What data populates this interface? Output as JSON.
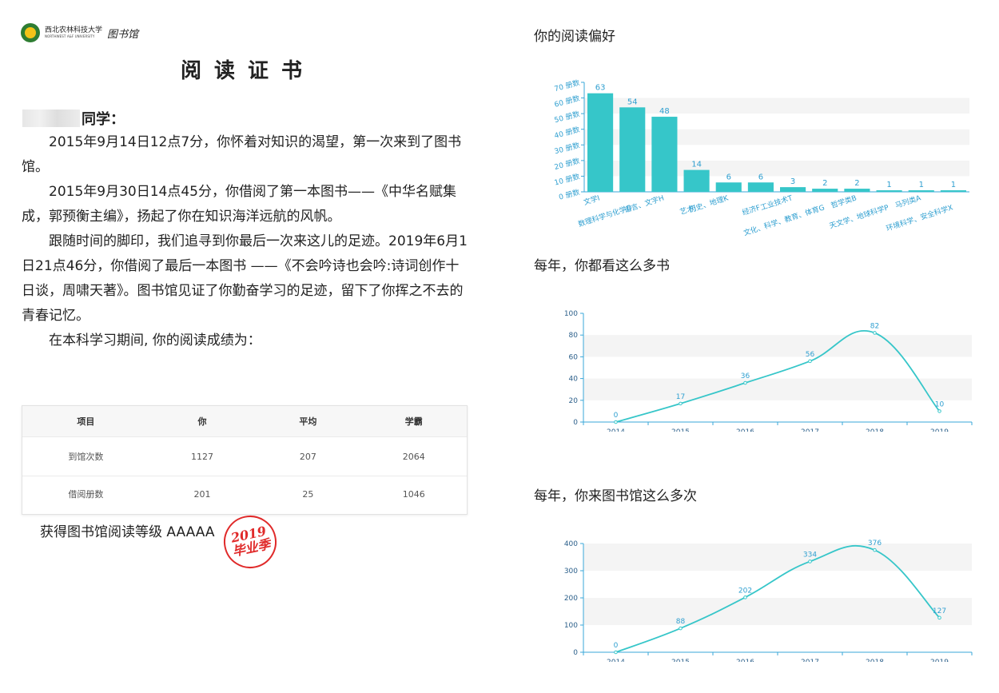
{
  "header": {
    "university_cn": "西北农林科技大学",
    "university_en": "NORTHWEST A&F UNIVERSITY",
    "library": "图书馆"
  },
  "certificate": {
    "title": "阅读证书",
    "greeting_suffix": "同学：",
    "paragraphs": [
      "2015年9月14日12点7分，你怀着对知识的渴望，第一次来到了图书馆。",
      "2015年9月30日14点45分，你借阅了第一本图书——《中华名赋集成，郭预衡主编》，扬起了你在知识海洋远航的风帆。",
      "跟随时间的脚印，我们追寻到你最后一次来这儿的足迹。2019年6月1日21点46分，你借阅了最后一本图书 ——《不会吟诗也会吟:诗词创作十日谈，周啸天著》。图书馆见证了你勤奋学习的足迹，留下了你挥之不去的青春记忆。",
      "在本科学习期间, 你的阅读成绩为："
    ],
    "table": {
      "headers": [
        "项目",
        "你",
        "平均",
        "学霸"
      ],
      "rows": [
        [
          "到馆次数",
          "1127",
          "207",
          "2064"
        ],
        [
          "借阅册数",
          "201",
          "25",
          "1046"
        ]
      ]
    },
    "grade": "获得图书馆阅读等级 AAAAA",
    "seal": {
      "year": "2019",
      "text": "毕业季"
    }
  },
  "sections": {
    "preference_title": "你的阅读偏好",
    "books_title": "每年，你都看这么多书",
    "visits_title": "每年，你来图书馆这么多次"
  },
  "colors": {
    "series": "#36c6c9",
    "axis": "#3aa7d8",
    "label": "#2f9fd0",
    "seal": "#e02a2a"
  },
  "chart_data": [
    {
      "type": "bar",
      "categories": [
        "文学I",
        "数理科学与化学O",
        "语言、文字H",
        "艺术J",
        "历史、地理K",
        "经济F",
        "工业技术T",
        "文化、科学、教育、体育G",
        "哲学类B",
        "天文学、地球科学P",
        "马列类A",
        "环境科学、安全科学X"
      ],
      "values": [
        63,
        54,
        48,
        14,
        6,
        6,
        3,
        2,
        2,
        1,
        1,
        1
      ],
      "ytick_labels": [
        "0 册数",
        "10 册数",
        "20 册数",
        "30 册数",
        "40 册数",
        "50 册数",
        "60 册数",
        "70 册数"
      ],
      "ylim": [
        0,
        70
      ]
    },
    {
      "type": "line",
      "x": [
        "2014",
        "2015",
        "2016",
        "2017",
        "2018",
        "2019"
      ],
      "values": [
        0,
        17,
        36,
        56,
        82,
        10
      ],
      "ylim": [
        0,
        100
      ],
      "yticks": [
        0,
        20,
        40,
        60,
        80,
        100
      ]
    },
    {
      "type": "line",
      "x": [
        "2014",
        "2015",
        "2016",
        "2017",
        "2018",
        "2019"
      ],
      "values": [
        0,
        88,
        202,
        334,
        376,
        127
      ],
      "ylim": [
        0,
        400
      ],
      "yticks": [
        0,
        100,
        200,
        300,
        400
      ]
    }
  ]
}
